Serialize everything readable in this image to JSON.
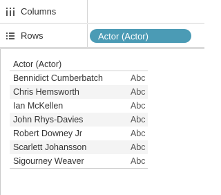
{
  "shelves": {
    "columns": {
      "label": "Columns",
      "icon": "columns-shelf-icon"
    },
    "rows": {
      "label": "Rows",
      "icon": "rows-shelf-icon",
      "pill": "Actor (Actor)"
    }
  },
  "colors": {
    "pill_background": "#4b9bb5",
    "pill_text": "#ffffff",
    "row_alt_background": "#f4f4f4"
  },
  "table": {
    "header": "Actor (Actor)",
    "rows": [
      {
        "name": "Bennidict Cumberbatch",
        "value": "Abc"
      },
      {
        "name": "Chris Hemsworth",
        "value": "Abc"
      },
      {
        "name": "Ian McKellen",
        "value": "Abc"
      },
      {
        "name": "John Rhys-Davies",
        "value": "Abc"
      },
      {
        "name": "Robert Downey Jr",
        "value": "Abc"
      },
      {
        "name": "Scarlett Johansson",
        "value": "Abc"
      },
      {
        "name": "Sigourney Weaver",
        "value": "Abc"
      }
    ]
  }
}
